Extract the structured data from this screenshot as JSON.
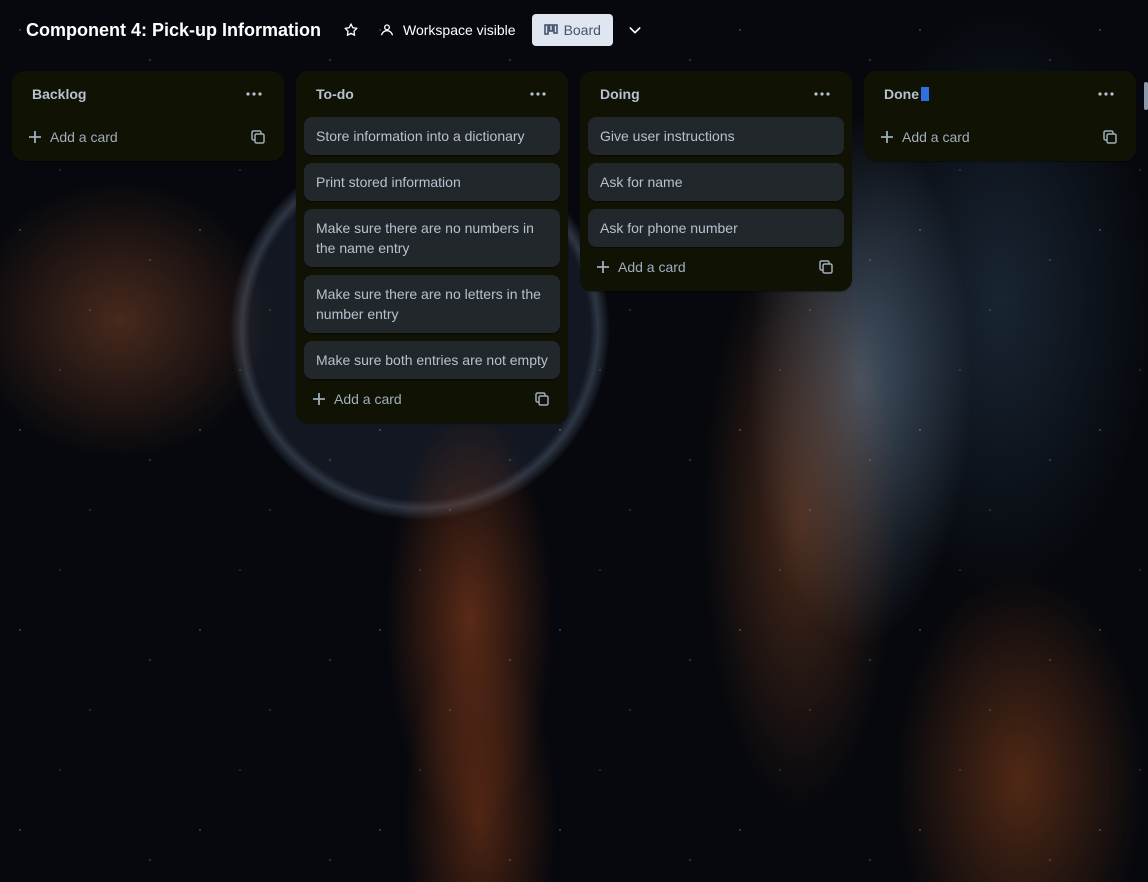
{
  "header": {
    "board_title": "Component 4: Pick-up Information",
    "visibility_label": "Workspace visible",
    "view_button_label": "Board",
    "icons": [
      "star-icon",
      "workspace-visibility-icon",
      "board-view-icon",
      "chevron-down-icon"
    ]
  },
  "lists": [
    {
      "title": "Backlog",
      "cards": [],
      "add_card_label": "Add a card"
    },
    {
      "title": "To-do",
      "cards": [
        "Store information into a dictionary",
        "Print stored information",
        "Make sure there are no numbers in the name entry",
        "Make sure there are no letters in the number entry",
        "Make sure both entries are not empty"
      ],
      "add_card_label": "Add a card"
    },
    {
      "title": "Doing",
      "cards": [
        "Give user instructions",
        "Ask for name",
        "Ask for phone number"
      ],
      "add_card_label": "Add a card"
    },
    {
      "title": "Done",
      "cards": [],
      "add_card_label": "Add a card"
    }
  ],
  "colors": {
    "list_bg": "#101204",
    "card_bg": "#22272b",
    "text": "#b6c2cf",
    "board_button_bg": "#dfe6ef"
  }
}
